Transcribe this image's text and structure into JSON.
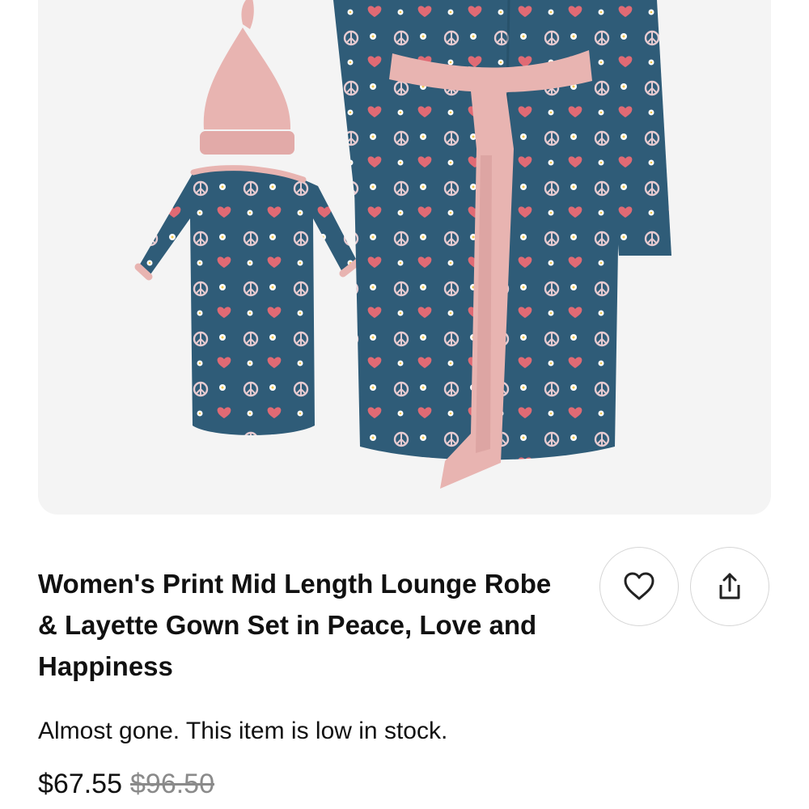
{
  "product": {
    "image_alt": "Women's Print Mid Length Lounge Robe & Layette Gown Set in Peace, Love and Happiness",
    "title": "Women's Print Mid Length Lounge Robe & Layette Gown Set in Peace, Love and Happiness",
    "stock_message": "Almost gone. This item is low in stock.",
    "sale_price": "$67.55",
    "original_price": "$96.50"
  },
  "actions": {
    "favorite_icon": "heart-outline-icon",
    "share_icon": "share-upload-icon"
  },
  "colors": {
    "fabric_teal": "#2f5c78",
    "trim_pink": "#e8b4b1",
    "heart_red": "#e06a74",
    "card_background": "#f4f4f4"
  }
}
